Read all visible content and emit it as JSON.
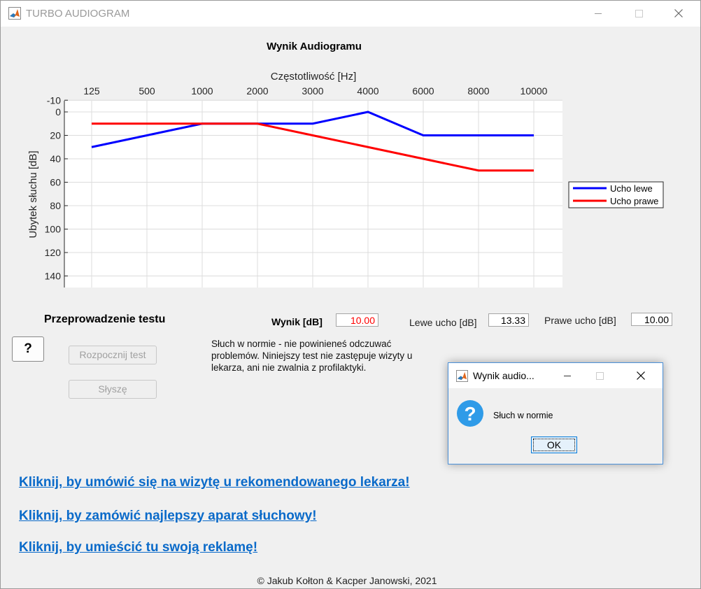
{
  "window": {
    "title": "TURBO AUDIOGRAM"
  },
  "plot": {
    "title": "Wynik Audiogramu"
  },
  "chart_data": {
    "type": "line",
    "title": "Wynik Audiogramu",
    "xlabel": "Częstotliwość [Hz]",
    "ylabel": "Ubytek słuchu [dB]",
    "categories": [
      "125",
      "500",
      "1000",
      "2000",
      "3000",
      "4000",
      "6000",
      "8000",
      "10000"
    ],
    "y_ticks": [
      "-10",
      "0",
      "20",
      "40",
      "60",
      "80",
      "100",
      "120",
      "140"
    ],
    "ylim": [
      -10,
      150
    ],
    "y_reversed": true,
    "x_axis_position": "top",
    "grid": true,
    "legend_position": "outside-right",
    "series": [
      {
        "name": "Ucho lewe",
        "color": "#0000ff",
        "values": [
          30,
          20,
          10,
          10,
          10,
          0,
          20,
          20,
          20
        ]
      },
      {
        "name": "Ucho prawe",
        "color": "#ff0000",
        "values": [
          10,
          10,
          10,
          10,
          20,
          30,
          40,
          50,
          50
        ]
      }
    ]
  },
  "test": {
    "title": "Przeprowadzenie testu",
    "help_label": "?",
    "start_label": "Rozpocznij test",
    "hear_label": "Słyszę"
  },
  "results": {
    "score_label": "Wynik [dB]",
    "score_value": "10.00",
    "left_label": "Lewe ucho [dB]",
    "left_value": "13.33",
    "right_label": "Prawe ucho [dB]",
    "right_value": "10.00",
    "message": "Słuch w normie - nie powinieneś odczuwać problemów. Niniejszy test nie zastępuje wizyty u lekarza, ani nie zwalnia z profilaktyki."
  },
  "links": [
    "Kliknij, by umówić się na wizytę u rekomendowanego lekarza!",
    "Kliknij, by zamówić najlepszy aparat słuchowy!",
    "Kliknij, by umieścić tu swoją reklamę!"
  ],
  "footer": "© Jakub Kołton & Kacper Janowski, 2021",
  "dialog": {
    "title": "Wynik audio...",
    "message": "Słuch w normie",
    "ok_label": "OK"
  },
  "colors": {
    "link": "#0a6ac9",
    "left_ear": "#0000ff",
    "right_ear": "#ff0000",
    "dialog_border": "#4a90d9"
  }
}
